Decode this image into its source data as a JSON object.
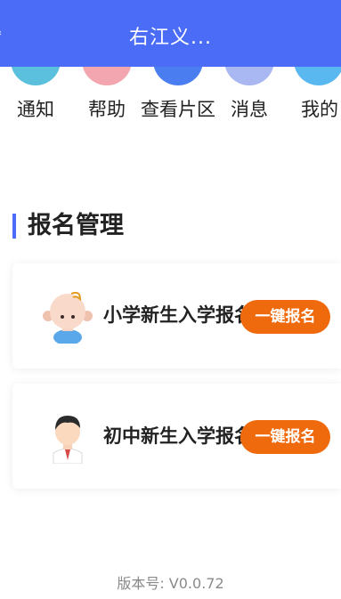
{
  "header": {
    "title": "右江义..."
  },
  "nav": {
    "items": [
      {
        "label": "通知",
        "color": "#5bc0de"
      },
      {
        "label": "帮助",
        "color": "#f4a6b0"
      },
      {
        "label": "查看片区",
        "color": "#4a7df0"
      },
      {
        "label": "消息",
        "color": "#a9b8f2"
      },
      {
        "label": "我的",
        "color": "#5ab8f0"
      }
    ]
  },
  "section": {
    "title": "报名管理"
  },
  "cards": [
    {
      "title": "小学新生入学报名",
      "button": "一键报名"
    },
    {
      "title": "初中新生入学报名",
      "button": "一键报名"
    }
  ],
  "footer": {
    "version": "版本号: V0.0.72"
  },
  "colors": {
    "header": "#4a6cf7",
    "accent_button": "#ef6a0d"
  }
}
